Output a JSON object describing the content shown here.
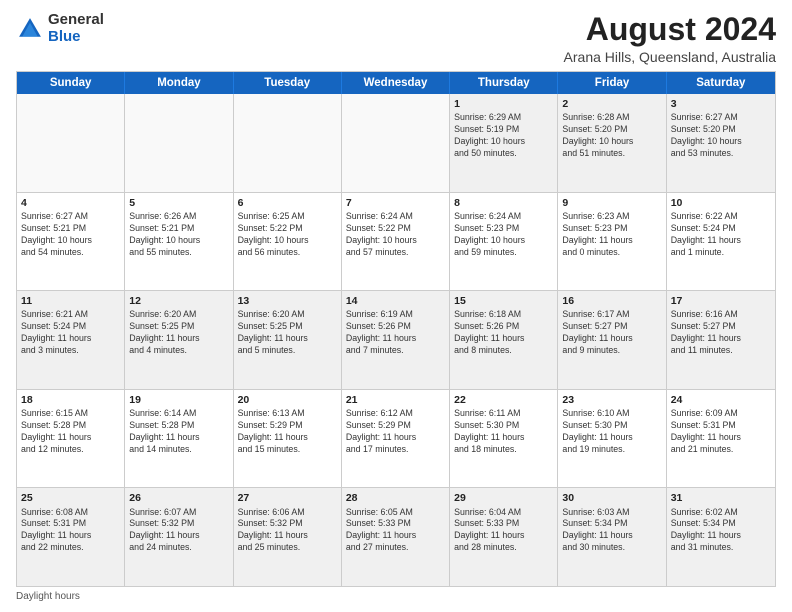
{
  "header": {
    "logo_line1": "General",
    "logo_line2": "Blue",
    "main_title": "August 2024",
    "subtitle": "Arana Hills, Queensland, Australia"
  },
  "days_of_week": [
    "Sunday",
    "Monday",
    "Tuesday",
    "Wednesday",
    "Thursday",
    "Friday",
    "Saturday"
  ],
  "weeks": [
    [
      {
        "day": "",
        "info": "",
        "empty": true
      },
      {
        "day": "",
        "info": "",
        "empty": true
      },
      {
        "day": "",
        "info": "",
        "empty": true
      },
      {
        "day": "",
        "info": "",
        "empty": true
      },
      {
        "day": "1",
        "info": "Sunrise: 6:29 AM\nSunset: 5:19 PM\nDaylight: 10 hours\nand 50 minutes.",
        "empty": false
      },
      {
        "day": "2",
        "info": "Sunrise: 6:28 AM\nSunset: 5:20 PM\nDaylight: 10 hours\nand 51 minutes.",
        "empty": false
      },
      {
        "day": "3",
        "info": "Sunrise: 6:27 AM\nSunset: 5:20 PM\nDaylight: 10 hours\nand 53 minutes.",
        "empty": false
      }
    ],
    [
      {
        "day": "4",
        "info": "Sunrise: 6:27 AM\nSunset: 5:21 PM\nDaylight: 10 hours\nand 54 minutes.",
        "empty": false
      },
      {
        "day": "5",
        "info": "Sunrise: 6:26 AM\nSunset: 5:21 PM\nDaylight: 10 hours\nand 55 minutes.",
        "empty": false
      },
      {
        "day": "6",
        "info": "Sunrise: 6:25 AM\nSunset: 5:22 PM\nDaylight: 10 hours\nand 56 minutes.",
        "empty": false
      },
      {
        "day": "7",
        "info": "Sunrise: 6:24 AM\nSunset: 5:22 PM\nDaylight: 10 hours\nand 57 minutes.",
        "empty": false
      },
      {
        "day": "8",
        "info": "Sunrise: 6:24 AM\nSunset: 5:23 PM\nDaylight: 10 hours\nand 59 minutes.",
        "empty": false
      },
      {
        "day": "9",
        "info": "Sunrise: 6:23 AM\nSunset: 5:23 PM\nDaylight: 11 hours\nand 0 minutes.",
        "empty": false
      },
      {
        "day": "10",
        "info": "Sunrise: 6:22 AM\nSunset: 5:24 PM\nDaylight: 11 hours\nand 1 minute.",
        "empty": false
      }
    ],
    [
      {
        "day": "11",
        "info": "Sunrise: 6:21 AM\nSunset: 5:24 PM\nDaylight: 11 hours\nand 3 minutes.",
        "empty": false
      },
      {
        "day": "12",
        "info": "Sunrise: 6:20 AM\nSunset: 5:25 PM\nDaylight: 11 hours\nand 4 minutes.",
        "empty": false
      },
      {
        "day": "13",
        "info": "Sunrise: 6:20 AM\nSunset: 5:25 PM\nDaylight: 11 hours\nand 5 minutes.",
        "empty": false
      },
      {
        "day": "14",
        "info": "Sunrise: 6:19 AM\nSunset: 5:26 PM\nDaylight: 11 hours\nand 7 minutes.",
        "empty": false
      },
      {
        "day": "15",
        "info": "Sunrise: 6:18 AM\nSunset: 5:26 PM\nDaylight: 11 hours\nand 8 minutes.",
        "empty": false
      },
      {
        "day": "16",
        "info": "Sunrise: 6:17 AM\nSunset: 5:27 PM\nDaylight: 11 hours\nand 9 minutes.",
        "empty": false
      },
      {
        "day": "17",
        "info": "Sunrise: 6:16 AM\nSunset: 5:27 PM\nDaylight: 11 hours\nand 11 minutes.",
        "empty": false
      }
    ],
    [
      {
        "day": "18",
        "info": "Sunrise: 6:15 AM\nSunset: 5:28 PM\nDaylight: 11 hours\nand 12 minutes.",
        "empty": false
      },
      {
        "day": "19",
        "info": "Sunrise: 6:14 AM\nSunset: 5:28 PM\nDaylight: 11 hours\nand 14 minutes.",
        "empty": false
      },
      {
        "day": "20",
        "info": "Sunrise: 6:13 AM\nSunset: 5:29 PM\nDaylight: 11 hours\nand 15 minutes.",
        "empty": false
      },
      {
        "day": "21",
        "info": "Sunrise: 6:12 AM\nSunset: 5:29 PM\nDaylight: 11 hours\nand 17 minutes.",
        "empty": false
      },
      {
        "day": "22",
        "info": "Sunrise: 6:11 AM\nSunset: 5:30 PM\nDaylight: 11 hours\nand 18 minutes.",
        "empty": false
      },
      {
        "day": "23",
        "info": "Sunrise: 6:10 AM\nSunset: 5:30 PM\nDaylight: 11 hours\nand 19 minutes.",
        "empty": false
      },
      {
        "day": "24",
        "info": "Sunrise: 6:09 AM\nSunset: 5:31 PM\nDaylight: 11 hours\nand 21 minutes.",
        "empty": false
      }
    ],
    [
      {
        "day": "25",
        "info": "Sunrise: 6:08 AM\nSunset: 5:31 PM\nDaylight: 11 hours\nand 22 minutes.",
        "empty": false
      },
      {
        "day": "26",
        "info": "Sunrise: 6:07 AM\nSunset: 5:32 PM\nDaylight: 11 hours\nand 24 minutes.",
        "empty": false
      },
      {
        "day": "27",
        "info": "Sunrise: 6:06 AM\nSunset: 5:32 PM\nDaylight: 11 hours\nand 25 minutes.",
        "empty": false
      },
      {
        "day": "28",
        "info": "Sunrise: 6:05 AM\nSunset: 5:33 PM\nDaylight: 11 hours\nand 27 minutes.",
        "empty": false
      },
      {
        "day": "29",
        "info": "Sunrise: 6:04 AM\nSunset: 5:33 PM\nDaylight: 11 hours\nand 28 minutes.",
        "empty": false
      },
      {
        "day": "30",
        "info": "Sunrise: 6:03 AM\nSunset: 5:34 PM\nDaylight: 11 hours\nand 30 minutes.",
        "empty": false
      },
      {
        "day": "31",
        "info": "Sunrise: 6:02 AM\nSunset: 5:34 PM\nDaylight: 11 hours\nand 31 minutes.",
        "empty": false
      }
    ]
  ],
  "footer": {
    "note": "Daylight hours"
  }
}
